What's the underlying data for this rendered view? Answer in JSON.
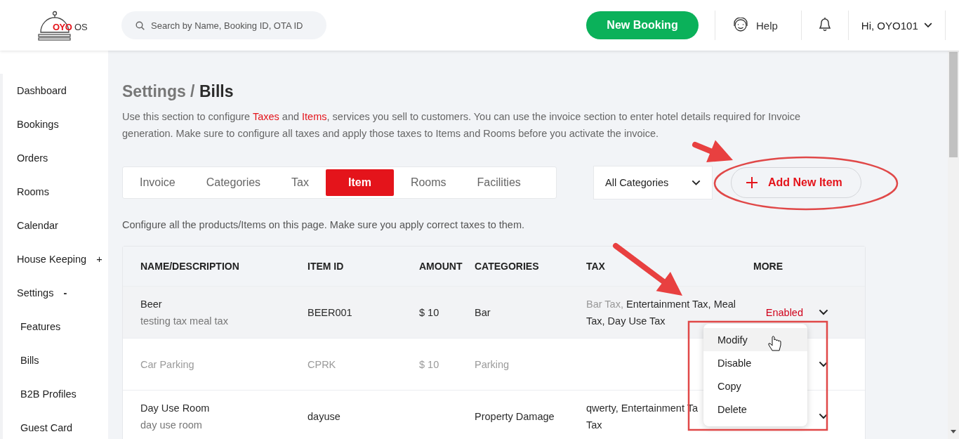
{
  "header": {
    "logo": {
      "brand": "OYO",
      "suffix": "OS"
    },
    "search": {
      "placeholder": "Search by Name, Booking ID, OTA ID"
    },
    "new_booking": "New Booking",
    "help": "Help",
    "user": "Hi, OYO101"
  },
  "sidebar": {
    "items": [
      {
        "label": "Dashboard"
      },
      {
        "label": "Bookings"
      },
      {
        "label": "Orders"
      },
      {
        "label": "Rooms"
      },
      {
        "label": "Calendar"
      },
      {
        "label": "House Keeping",
        "toggle": "+",
        "expanded": false
      },
      {
        "label": "Settings",
        "toggle": "-",
        "expanded": true,
        "children": [
          {
            "label": "Features"
          },
          {
            "label": "Bills"
          },
          {
            "label": "B2B Profiles"
          },
          {
            "label": "Guest Card"
          }
        ]
      }
    ]
  },
  "page": {
    "breadcrumb": {
      "parent": "Settings /",
      "current": "Bills"
    },
    "description": [
      {
        "text": "Use this section to configure ",
        "highlight": false
      },
      {
        "text": "Taxes",
        "highlight": true
      },
      {
        "text": " and ",
        "highlight": false
      },
      {
        "text": "Items",
        "highlight": true
      },
      {
        "text": ", services you sell to customers. You can use the invoice section to enter hotel details required for Invoice generation. Make sure to configure all taxes and apply those taxes to Items and Rooms before you activate the invoice.",
        "highlight": false
      }
    ],
    "tabs": [
      {
        "label": "Invoice",
        "selected": false
      },
      {
        "label": "Categories",
        "selected": false
      },
      {
        "label": "Tax",
        "selected": false
      },
      {
        "label": "Item",
        "selected": true
      },
      {
        "label": "Rooms",
        "selected": false
      },
      {
        "label": "Facilities",
        "selected": false
      }
    ],
    "category_filter": "All Categories",
    "add_button": "Add New Item",
    "hint": "Configure all the products/Items on this page. Make sure you apply correct taxes to them."
  },
  "table": {
    "columns": [
      "NAME/DESCRIPTION",
      "ITEM ID",
      "AMOUNT",
      "CATEGORIES",
      "TAX",
      "MORE"
    ],
    "rows": [
      {
        "name": "Beer",
        "description": "testing tax meal tax",
        "item_id": "BEER001",
        "amount": "$ 10",
        "category": "Bar",
        "disabled": false,
        "highlighted": true,
        "tax_lines": [
          [
            {
              "text": "Bar Tax,",
              "muted": true
            },
            {
              "text": "Entertainment Tax, Meal",
              "muted": false
            }
          ],
          [
            {
              "text": "Tax, Day Use Tax",
              "muted": false
            }
          ]
        ],
        "status": "Enabled"
      },
      {
        "name": "Car Parking",
        "item_id": "CPRK",
        "amount": "$ 10",
        "category": "Parking",
        "disabled": true,
        "highlighted": false
      },
      {
        "name": "Day Use Room",
        "description": "day use room",
        "item_id": "dayuse",
        "category": "Property Damage",
        "disabled": false,
        "highlighted": false,
        "tax_lines": [
          [
            {
              "text": "qwerty, Entertainment Ta",
              "muted": false
            }
          ],
          [
            {
              "text": "Tax",
              "muted": false
            }
          ]
        ]
      }
    ]
  },
  "menu": {
    "items": [
      {
        "label": "Modify",
        "selected": true
      },
      {
        "label": "Disable",
        "selected": false
      },
      {
        "label": "Copy",
        "selected": false
      },
      {
        "label": "Delete",
        "selected": false
      }
    ]
  }
}
